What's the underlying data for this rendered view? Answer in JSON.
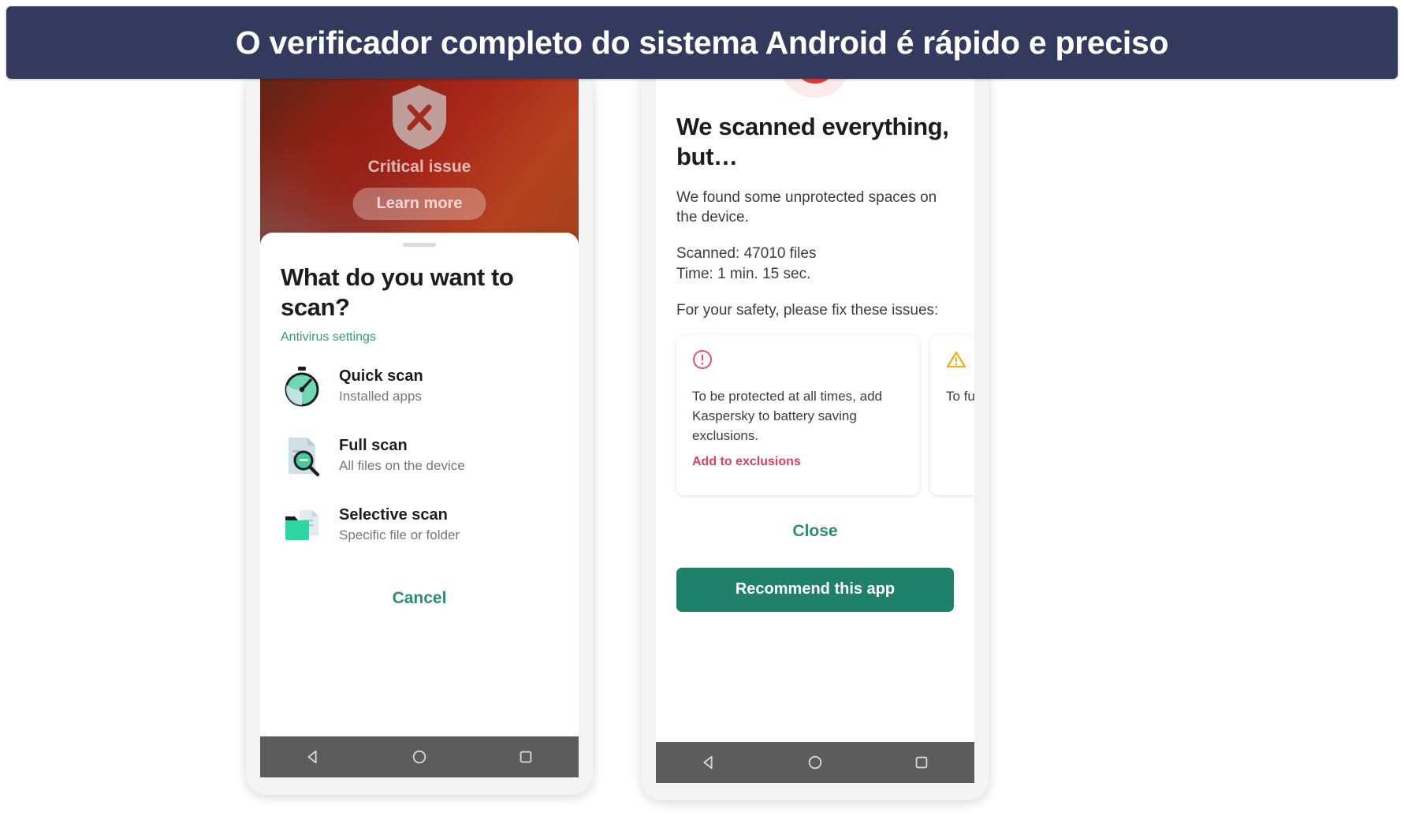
{
  "banner": {
    "text": "O verificador completo do sistema Android é rápido e preciso",
    "background_color": "#333a5e",
    "text_color": "#ffffff"
  },
  "colors": {
    "accent_green": "#2b8f6d",
    "button_green": "#1f8169",
    "link_green": "#2f9c78",
    "alert_red": "#d9435c",
    "warning_amber": "#f0ad17",
    "hero_red": "#a8271a",
    "navbar_gray": "#5c5c5c"
  },
  "left_phone": {
    "hero": {
      "icon": "shield-x-icon",
      "status_label": "Critical issue",
      "learn_more_label": "Learn more"
    },
    "sheet": {
      "title": "What do you want to scan?",
      "settings_link": "Antivirus settings",
      "scan_options": [
        {
          "icon": "stopwatch-icon",
          "name": "Quick scan",
          "subtitle": "Installed apps"
        },
        {
          "icon": "file-magnifier-icon",
          "name": "Full scan",
          "subtitle": "All files on the device"
        },
        {
          "icon": "folder-file-icon",
          "name": "Selective scan",
          "subtitle": "Specific file or folder"
        }
      ],
      "cancel_label": "Cancel"
    },
    "navbar": {
      "back": "back-icon",
      "home": "home-icon",
      "recents": "recents-icon"
    }
  },
  "right_phone": {
    "badge": {
      "icon": "exclamation-icon",
      "glyph": "!"
    },
    "title": "We scanned everything, but…",
    "description": "We found some unprotected spaces on the device.",
    "stats": {
      "scanned_line": "Scanned: 47010 files",
      "time_line": "Time: 1 min. 15 sec."
    },
    "fix_prompt": "For your safety, please fix these issues:",
    "issue_cards": [
      {
        "icon": "alert-circle-icon",
        "severity": "critical",
        "text": "To be protected at all times, add Kaspersky to battery saving exclusions.",
        "action_label": "Add to exclusions"
      },
      {
        "icon": "warning-triangle-icon",
        "severity": "warning",
        "text": "To fu app r folde",
        "action_label": ""
      }
    ],
    "close_label": "Close",
    "recommend_label": "Recommend this app",
    "navbar": {
      "back": "back-icon",
      "home": "home-icon",
      "recents": "recents-icon"
    }
  }
}
